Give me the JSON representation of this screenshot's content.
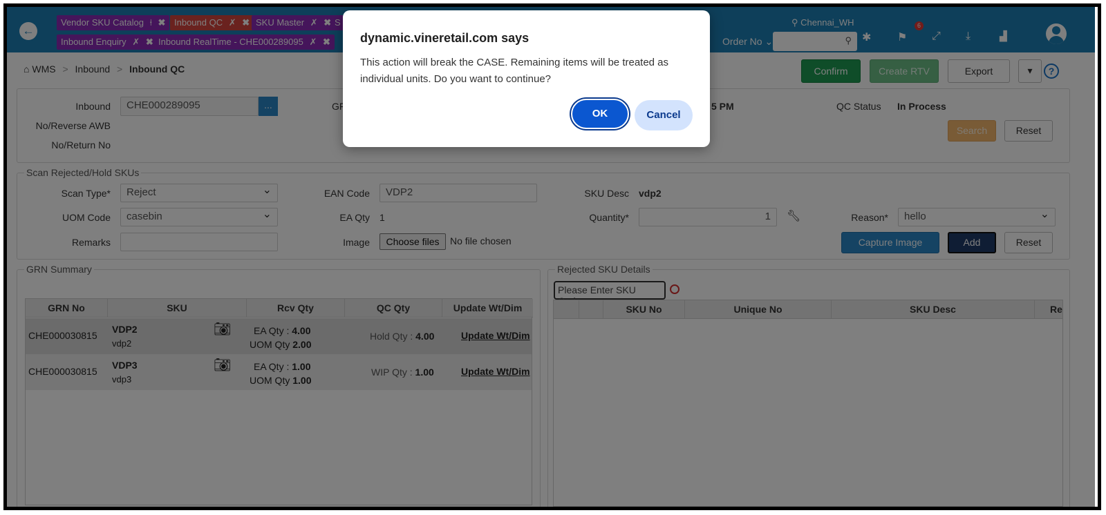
{
  "tabs": [
    {
      "label": "Vendor SKU Catalog",
      "pin": "⍿",
      "close": "✖",
      "color": "purple"
    },
    {
      "label": "Inbound QC",
      "pin": "✗",
      "close": "✖",
      "color": "red"
    },
    {
      "label": "SKU Master",
      "pin": "✗",
      "close": "✖",
      "color": "purple"
    },
    {
      "label": "S",
      "pin": "",
      "close": "",
      "color": "purple"
    },
    {
      "label": "Inbound Enquiry",
      "pin": "✗",
      "close": "✖",
      "color": "purple"
    },
    {
      "label": "Inbound RealTime - CHE000289095",
      "pin": "✗",
      "close": "✖",
      "color": "purple"
    }
  ],
  "header": {
    "location": "Chennai_WH",
    "order_no_label": "Order No",
    "notification_count": "6"
  },
  "breadcrumb": {
    "home": "WMS",
    "section": "Inbound",
    "current": "Inbound QC"
  },
  "toolbar": {
    "confirm": "Confirm",
    "create_rtv": "Create RTV",
    "export": "Export",
    "help": "?"
  },
  "inbound_form": {
    "inbound_label": "Inbound",
    "inbound_value": "CHE000289095",
    "lookup": "...",
    "gr_label_partial": "GF",
    "reverse_awb_label": "No/Reverse AWB",
    "return_no_label": "No/Return No",
    "time_partial": "5 PM",
    "qc_status_label": "QC Status",
    "qc_status_value": "In Process",
    "search": "Search",
    "reset": "Reset"
  },
  "scan_section": {
    "legend": "Scan Rejected/Hold SKUs",
    "scan_type_label": "Scan Type*",
    "scan_type_value": "Reject",
    "uom_code_label": "UOM Code",
    "uom_code_value": "casebin",
    "remarks_label": "Remarks",
    "ean_code_label": "EAN Code",
    "ean_code_value": "VDP2",
    "ea_qty_label": "EA Qty",
    "ea_qty_value": "1",
    "image_label": "Image",
    "choose_files": "Choose files",
    "no_file": "No file chosen",
    "sku_desc_label": "SKU Desc",
    "sku_desc_value": "vdp2",
    "quantity_label": "Quantity*",
    "quantity_value": "1",
    "reason_label": "Reason*",
    "reason_value": "hello",
    "capture_image": "Capture Image",
    "add": "Add",
    "reset": "Reset"
  },
  "grn_summary": {
    "legend": "GRN Summary",
    "columns": [
      "GRN No",
      "SKU",
      "Rcv Qty",
      "QC Qty",
      "Update Wt/Dim"
    ],
    "rows": [
      {
        "grn_no": "CHE000030815",
        "sku_code": "VDP2",
        "sku_desc": "vdp2",
        "ea_qty_label": "EA Qty :",
        "ea_qty": "4.00",
        "uom_qty_label": "UOM Qty",
        "uom_qty": "2.00",
        "qc_label": "Hold Qty :",
        "qc_qty": "4.00",
        "update": "Update Wt/Dim"
      },
      {
        "grn_no": "CHE000030815",
        "sku_code": "VDP3",
        "sku_desc": "vdp3",
        "ea_qty_label": "EA Qty :",
        "ea_qty": "1.00",
        "uom_qty_label": "UOM Qty",
        "uom_qty": "1.00",
        "qc_label": "WIP Qty :",
        "qc_qty": "1.00",
        "update": "Update Wt/Dim"
      }
    ]
  },
  "rejected_sku": {
    "legend": "Rejected SKU Details",
    "search_placeholder": "Please Enter SKU Code",
    "columns": [
      "",
      "",
      "SKU No",
      "Unique No",
      "SKU Desc",
      "Re"
    ]
  },
  "dialog": {
    "title": "dynamic.vineretail.com says",
    "message": "This action will break the CASE. Remaining items will be treated as individual units. Do you want to continue?",
    "ok": "OK",
    "cancel": "Cancel"
  }
}
